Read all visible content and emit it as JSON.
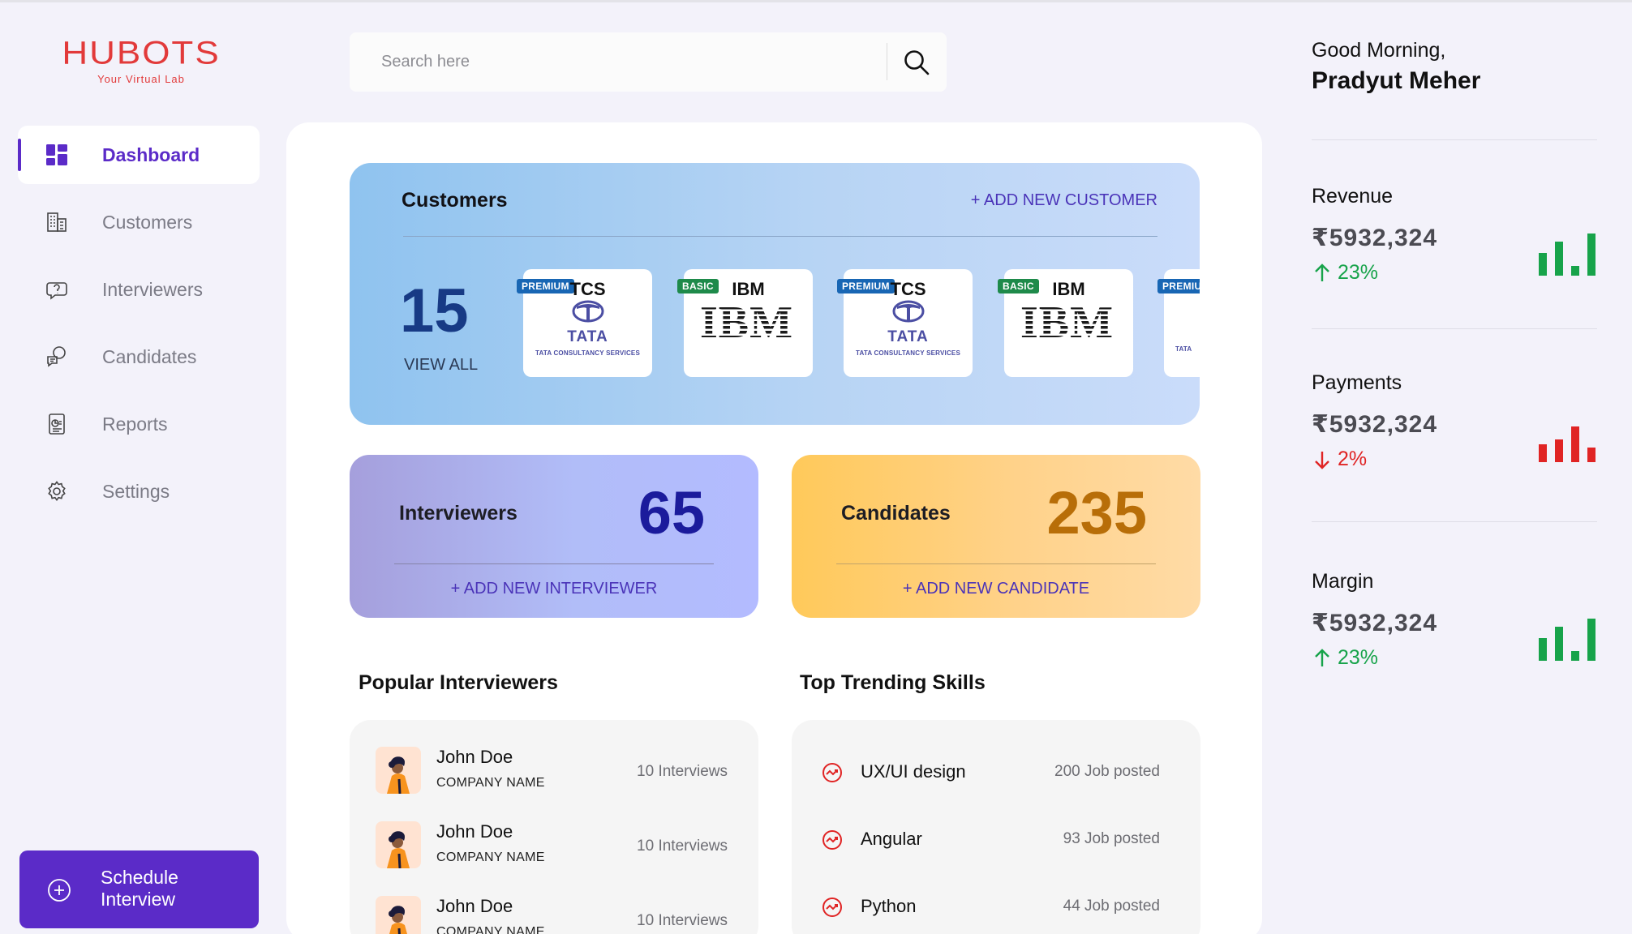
{
  "brand": {
    "name": "HUBOTS",
    "tagline": "Your Virtual Lab"
  },
  "search": {
    "placeholder": "Search here"
  },
  "nav": {
    "items": [
      {
        "label": "Dashboard",
        "icon": "dashboard-icon",
        "active": true
      },
      {
        "label": "Customers",
        "icon": "building-icon"
      },
      {
        "label": "Interviewers",
        "icon": "chat-bubble-icon"
      },
      {
        "label": "Candidates",
        "icon": "user-chat-icon"
      },
      {
        "label": "Reports",
        "icon": "report-icon"
      },
      {
        "label": "Settings",
        "icon": "gear-icon"
      }
    ]
  },
  "schedule": {
    "label": "Schedule Interview"
  },
  "customers": {
    "title": "Customers",
    "add_label": "+ ADD NEW CUSTOMER",
    "count": "15",
    "view_all": "VIEW ALL",
    "logos": [
      {
        "name": "TCS",
        "tier": "PREMIUM",
        "brand": "TATA",
        "sub": "TATA CONSULTANCY SERVICES"
      },
      {
        "name": "IBM",
        "tier": "BASIC",
        "brand": "IBM"
      },
      {
        "name": "TCS",
        "tier": "PREMIUM",
        "brand": "TATA",
        "sub": "TATA CONSULTANCY SERVICES"
      },
      {
        "name": "IBM",
        "tier": "BASIC",
        "brand": "IBM"
      },
      {
        "name": "",
        "tier": "PREMIUM",
        "brand": "TATA",
        "sub": "TATA"
      }
    ]
  },
  "interviewers_card": {
    "label": "Interviewers",
    "value": "65",
    "add_label": "+ ADD NEW INTERVIEWER"
  },
  "candidates_card": {
    "label": "Candidates",
    "value": "235",
    "add_label": "+ ADD NEW CANDIDATE"
  },
  "popular": {
    "title": "Popular Interviewers",
    "rows": [
      {
        "name": "John Doe",
        "company": "COMPANY NAME",
        "count": "10 Interviews"
      },
      {
        "name": "John Doe",
        "company": "COMPANY NAME",
        "count": "10 Interviews"
      },
      {
        "name": "John Doe",
        "company": "COMPANY NAME",
        "count": "10 Interviews"
      }
    ]
  },
  "skills": {
    "title": "Top Trending Skills",
    "rows": [
      {
        "name": "UX/UI design",
        "count": "200 Job posted"
      },
      {
        "name": "Angular",
        "count": "93 Job posted"
      },
      {
        "name": "Python",
        "count": "44 Job posted"
      }
    ]
  },
  "greeting": {
    "text": "Good Morning,",
    "name": "Pradyut Meher"
  },
  "metrics": [
    {
      "label": "Revenue",
      "value": "₹5932,324",
      "change": "23%",
      "direction": "up",
      "color": "#17a34a"
    },
    {
      "label": "Payments",
      "value": "₹5932,324",
      "change": "2%",
      "direction": "down",
      "color": "#e02424"
    },
    {
      "label": "Margin",
      "value": "₹5932,324",
      "change": "23%",
      "direction": "up",
      "color": "#17a34a"
    }
  ],
  "colors": {
    "accent": "#5b2bc8",
    "brand_red": "#e23a3a",
    "up": "#17a34a",
    "down": "#e02424"
  }
}
